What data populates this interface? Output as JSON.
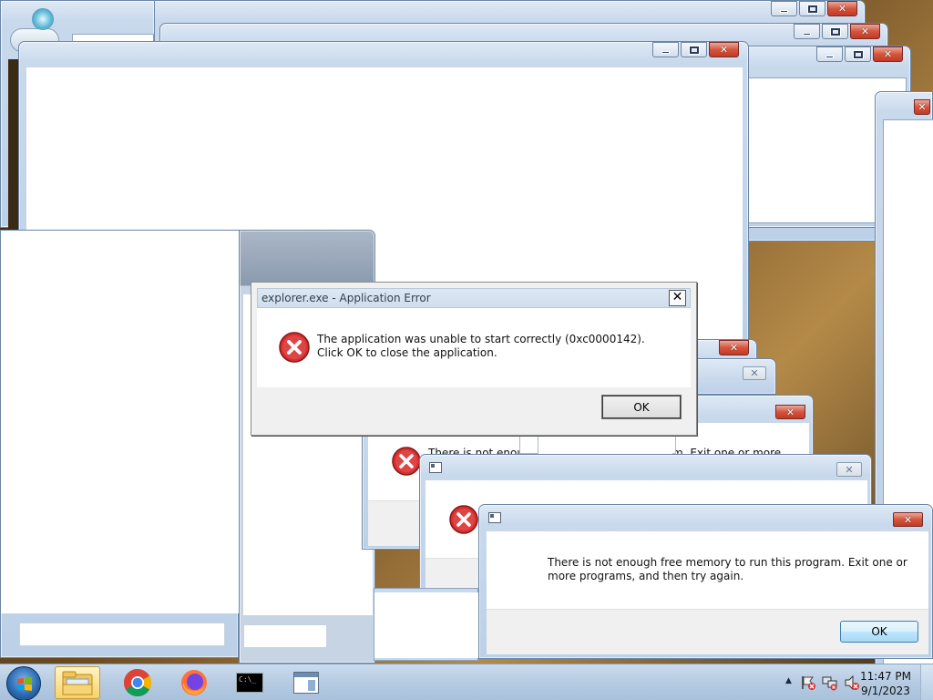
{
  "dialogs": {
    "explorer_error": {
      "title": "explorer.exe - Application Error",
      "close_glyph": "✕",
      "message": "The application was unable to start correctly (0xc0000142). Click OK to close the application.",
      "ok_label": "OK",
      "icon": "error-icon"
    },
    "memory_error": {
      "message": "There is not enough free memory to run this program. Exit one or more programs, and then try again.",
      "ok_label": "OK",
      "icon": "error-icon"
    },
    "partial_texts": {
      "left": "There is not enoug",
      "right": "m. Exit one or more"
    }
  },
  "caption_buttons": {
    "close_glyph": "✕"
  },
  "taskbar": {
    "items": [
      {
        "name": "start-button",
        "icon": "windows-orb-icon"
      },
      {
        "name": "file-explorer",
        "icon": "folder-icon"
      },
      {
        "name": "chrome",
        "icon": "chrome-icon"
      },
      {
        "name": "firefox",
        "icon": "firefox-icon"
      },
      {
        "name": "command-prompt",
        "icon": "cmd-icon",
        "glyph": "C:\\_"
      },
      {
        "name": "app-window",
        "icon": "window-icon"
      }
    ],
    "tray": {
      "show_hidden": "▲",
      "time": "11:47 PM",
      "date": "9/1/2023"
    }
  },
  "colors": {
    "aero_frame": "#bcd0e8",
    "close_red": "#c13a25",
    "error_red": "#d62f2f",
    "taskbar": "#b6cbe2"
  }
}
